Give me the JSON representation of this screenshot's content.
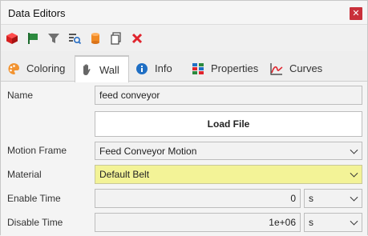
{
  "window": {
    "title": "Data Editors",
    "close_glyph": "✕"
  },
  "toolbar": {
    "icons": [
      "red-cube-icon",
      "green-flag-icon",
      "funnel-icon",
      "search-list-icon",
      "orange-cylinder-icon",
      "copy-icon",
      "delete-icon"
    ]
  },
  "tabs": [
    {
      "label": "Coloring",
      "icon": "palette-icon"
    },
    {
      "label": "Wall",
      "icon": "hand-icon",
      "active": true
    },
    {
      "label": "Info",
      "icon": "info-icon"
    },
    {
      "label": "Properties",
      "icon": "properties-icon"
    },
    {
      "label": "Curves",
      "icon": "curves-icon"
    }
  ],
  "form": {
    "name_label": "Name",
    "name_value": "feed conveyor",
    "load_file_label": "Load File",
    "motion_frame_label": "Motion Frame",
    "motion_frame_value": "Feed Conveyor Motion",
    "material_label": "Material",
    "material_value": "Default Belt",
    "enable_time_label": "Enable Time",
    "enable_time_value": "0",
    "enable_time_unit": "s",
    "disable_time_label": "Disable Time",
    "disable_time_value": "1e+06",
    "disable_time_unit": "s"
  },
  "colors": {
    "material_highlight": "#f3f397",
    "close_button": "#c9303a",
    "info_blue": "#1f6fc4"
  }
}
